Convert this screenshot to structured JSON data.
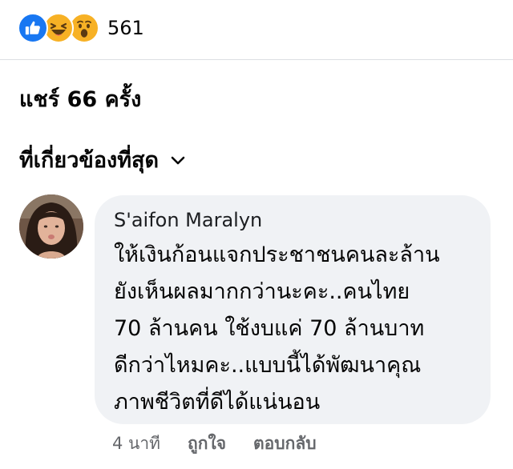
{
  "reactions": {
    "icons": [
      "like-icon",
      "haha-icon",
      "wow-icon"
    ],
    "count": "561"
  },
  "shares": {
    "label": "แชร์ 66 ครั้ง"
  },
  "comment_filter": {
    "label": "ที่เกี่ยวข้องที่สุด",
    "icon": "chevron-down-icon"
  },
  "comment": {
    "author": "S'aifon Maralyn",
    "text_lines": [
      "ให้เงินก้อนแจกประชาชนคนละล้าน",
      "ยังเห็นผลมากกว่านะคะ..คนไทย",
      "70 ล้านคน ใช้งบแค่ 70 ล้านบาท",
      "ดีกว่าไหมคะ..แบบนี้ได้พัฒนาคุณ",
      "ภาพชีวิตที่ดีได้แน่นอน"
    ],
    "time": "4 นาที",
    "like_label": "ถูกใจ",
    "reply_label": "ตอบกลับ"
  },
  "colors": {
    "like": "#1877f2",
    "reaction_yellow": "#f7b125",
    "bubble_bg": "#f0f2f5",
    "meta_text": "#65676b"
  }
}
